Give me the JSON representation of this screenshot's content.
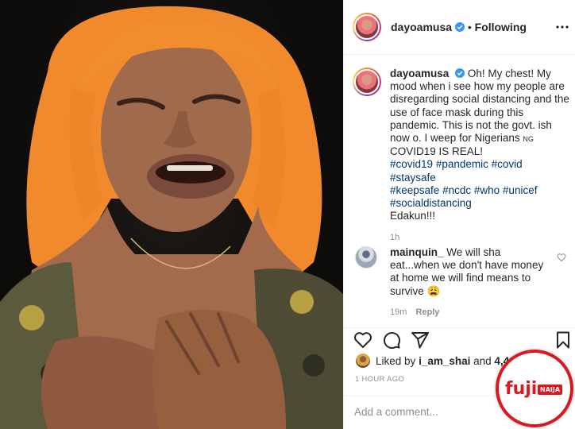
{
  "header": {
    "username": "dayoamusa",
    "separator": "•",
    "follow_status": "Following"
  },
  "caption": {
    "username": "dayoamusa",
    "text_1": "Oh! My chest! My mood when i see how my people are disregarding social distancing and the use of face mask during this pandemic. This is not the govt. ish now o. I weep for Nigerians",
    "flag_text": "NG",
    "text_2": "COVID19 IS REAL!",
    "hashtags": [
      "#covid19",
      "#pandemic",
      "#covid",
      "#staysafe",
      "#keepsafe",
      "#ncdc",
      "#who",
      "#unicef",
      "#socialdistancing"
    ],
    "text_3": "Edakun!!!",
    "time": "1h"
  },
  "comment": {
    "username": "mainquin_",
    "text": "We will sha eat...when we don't have money at home we will find means to survive 😩",
    "time": "19m",
    "reply_label": "Reply"
  },
  "likes": {
    "prefix": "Liked by",
    "user": "i_am_shai",
    "joiner": "and",
    "count": "4,426"
  },
  "posted_ago": "1 HOUR AGO",
  "add_comment": {
    "placeholder": "Add a comment..."
  },
  "watermark": {
    "brand": "fuji",
    "tag": "NAIJA"
  },
  "icons": {
    "verified": "verified-badge-icon",
    "more": "more-options-icon",
    "like": "heart-icon",
    "comment": "comment-icon",
    "share": "share-icon",
    "save": "bookmark-icon"
  },
  "colors": {
    "verified": "#3897f0",
    "link": "#00376b",
    "muted": "#8e8e8e",
    "watermark": "#d71920"
  }
}
